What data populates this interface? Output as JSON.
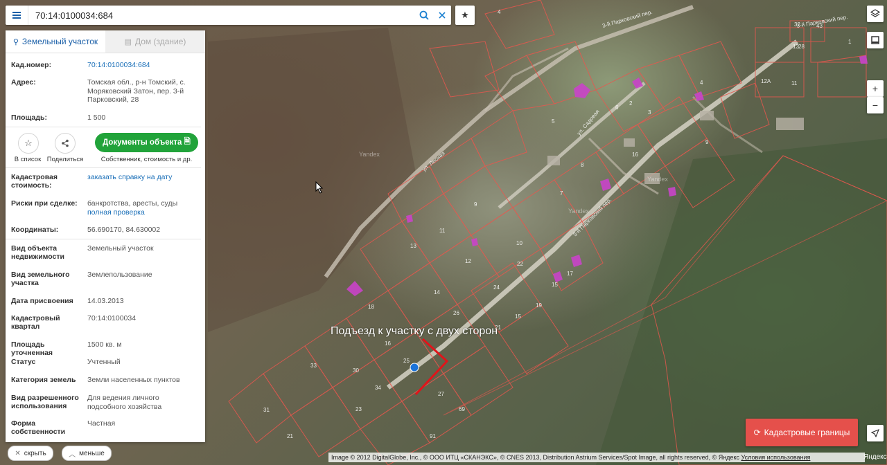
{
  "search": {
    "value": "70:14:0100034:684"
  },
  "tabs": [
    {
      "label": "Земельный участок",
      "active": true
    },
    {
      "label": "Дом (здание)",
      "active": false
    }
  ],
  "info": {
    "cadnum_label": "Кад.номер:",
    "cadnum_value": "70:14:0100034:684",
    "address_label": "Адрес:",
    "address_value": "Томская обл., р-н Томский, с. Моряковский Затон, пер. 3-й Парковский, 28",
    "area_label": "Площадь:",
    "area_value": "1 500"
  },
  "actions": {
    "favorite_label": "В список",
    "share_label": "Поделиться",
    "documents_label": "Документы объекта",
    "documents_sub": "Собственник, стоимость и др."
  },
  "details": {
    "cost_label": "Кадастровая стоимость:",
    "cost_link": "заказать справку на дату",
    "risks_label": "Риски при сделке:",
    "risks_value": "банкротства, аресты, суды",
    "risks_link": "полная проверка",
    "coords_label": "Координаты:",
    "coords_value": "56.690170, 84.630002",
    "object_type_label": "Вид объекта недвижимости",
    "object_type_value": "Земельный участок",
    "land_type_label": "Вид земельного участка",
    "land_type_value": "Землепользование",
    "date_label": "Дата присвоения",
    "date_value": "14.03.2013",
    "quarter_label": "Кадастровый квартал",
    "quarter_value": "70:14:0100034",
    "precise_area_label": "Площадь уточненная",
    "precise_area_value": "1500 кв. м",
    "status_label": "Статус",
    "status_value": "Учтенный",
    "category_label": "Категория земель",
    "category_value": "Земли населенных пунктов",
    "usage_label": "Вид разрешенного использования",
    "usage_value": "Для ведения личного подсобного хозяйства",
    "ownership_label": "Форма собственности",
    "ownership_value": "Частная"
  },
  "bottom": {
    "hide_label": "скрыть",
    "less_label": "меньше"
  },
  "map": {
    "annotation": "Подъезд к участку с двух сторон",
    "cad_button": "Кадастровые границы",
    "attribution": "Image © 2012 DigitalGlobe, Inc., © ООО ИТЦ «СКАНЭКС», © CNES 2013, Distribution Astrium Services/Spot Image, all rights reserved, © Яндекс",
    "terms_link": "Условия использования",
    "logo": "Яндекс",
    "street_labels": [
      "3-й Парковский пер.",
      "ул. Лесная",
      "ул. Садовая",
      "3-й Парковский пер.",
      "3-й Парковский пер."
    ],
    "watermarks": [
      "Yandex",
      "Yandex",
      "Yandex"
    ],
    "plot_numbers": [
      "4",
      "2",
      "13",
      "11",
      "9",
      "10",
      "12",
      "22",
      "24",
      "14",
      "26",
      "16",
      "25",
      "27",
      "69",
      "91",
      "31",
      "21",
      "23",
      "34",
      "30",
      "33",
      "18",
      "15",
      "17",
      "19",
      "15",
      "21",
      "3",
      "5",
      "8",
      "6",
      "4",
      "28",
      "1",
      "12А",
      "11",
      "13",
      "16",
      "9",
      "32",
      "7",
      "43"
    ],
    "accent": "#e5504b"
  }
}
